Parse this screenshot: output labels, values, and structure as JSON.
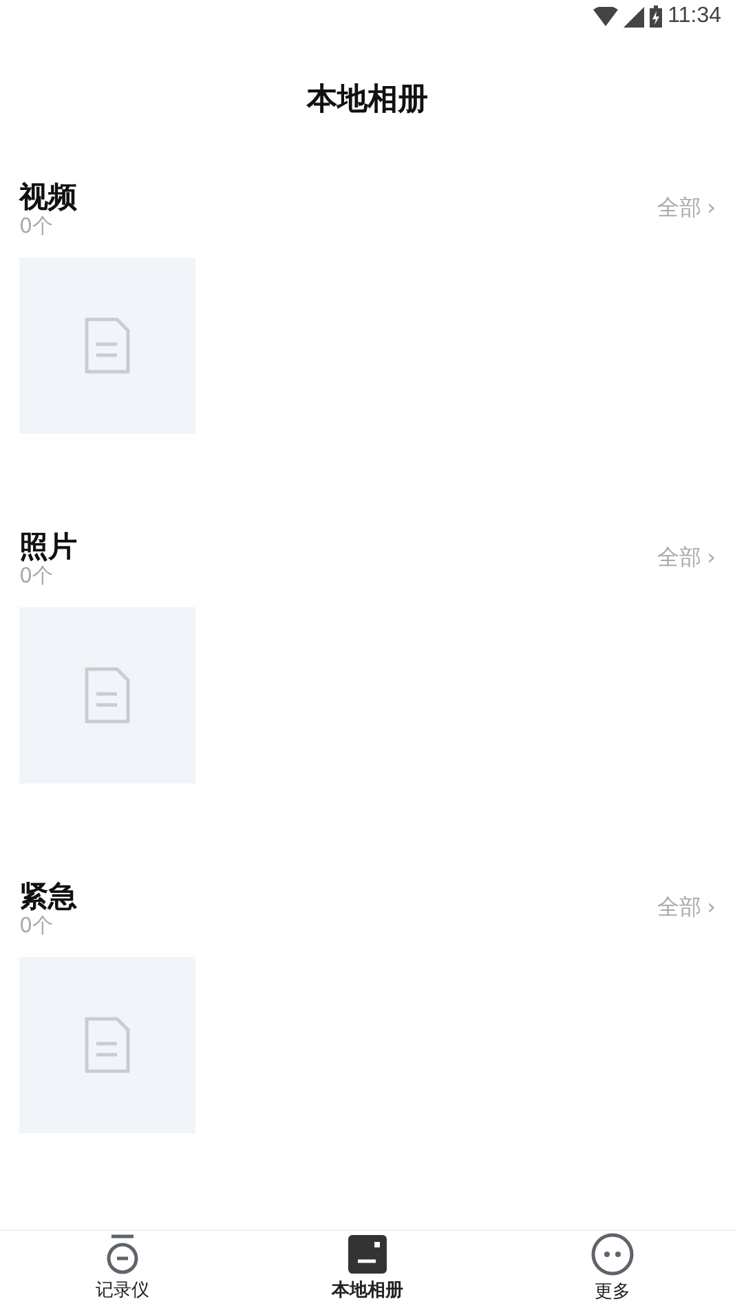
{
  "status_bar": {
    "time": "11:34"
  },
  "title": "本地相册",
  "sections": [
    {
      "name": "视频",
      "count": "0个",
      "more": "全部",
      "more_arrow": "›"
    },
    {
      "name": "照片",
      "count": "0个",
      "more": "全部",
      "more_arrow": "›"
    },
    {
      "name": "紧急",
      "count": "0个",
      "more": "全部",
      "more_arrow": "›"
    }
  ],
  "tabs": [
    {
      "label": "记录仪",
      "kind": "recorder",
      "selected": false
    },
    {
      "label": "本地相册",
      "kind": "album",
      "selected": true
    },
    {
      "label": "更多",
      "kind": "more",
      "selected": false
    }
  ]
}
